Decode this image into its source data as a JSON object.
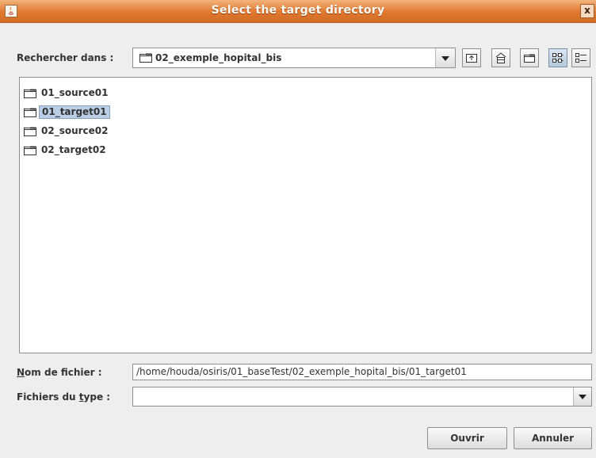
{
  "window": {
    "title": "Select the target directory",
    "close_symbol": "x"
  },
  "lookin": {
    "label": "Rechercher dans :",
    "value": "02_exemple_hopital_bis"
  },
  "toolbar": {
    "buttons": [
      {
        "name": "up-one-level-icon"
      },
      {
        "name": "home-icon"
      },
      {
        "name": "new-folder-icon"
      },
      {
        "name": "list-view-icon",
        "selected": true
      },
      {
        "name": "details-view-icon"
      }
    ]
  },
  "files": [
    {
      "label": "01_source01",
      "selected": false
    },
    {
      "label": "01_target01",
      "selected": true
    },
    {
      "label": "02_source02",
      "selected": false
    },
    {
      "label": "02_target02",
      "selected": false
    }
  ],
  "filename": {
    "label_mnemonic": "N",
    "label_rest": "om de fichier :",
    "value": "/home/houda/osiris/01_baseTest/02_exemple_hopital_bis/01_target01"
  },
  "filetype": {
    "label_pre": "Fichiers du ",
    "label_mnemonic": "t",
    "label_post": "ype :",
    "value": ""
  },
  "buttons": {
    "open": "Ouvrir",
    "cancel": "Annuler"
  },
  "colors": {
    "titlebar": "#e0782f",
    "selection": "#b8cfe5"
  }
}
